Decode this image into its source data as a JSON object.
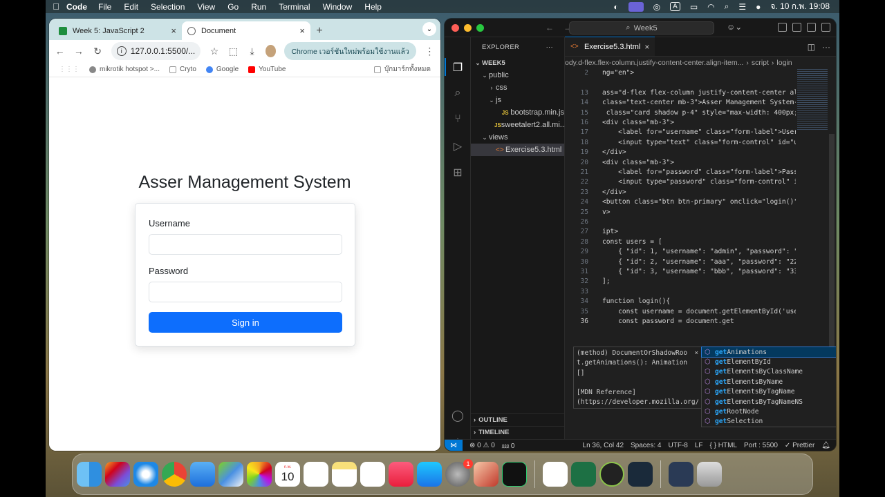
{
  "menubar": {
    "app": "Code",
    "items": [
      "File",
      "Edit",
      "Selection",
      "View",
      "Go",
      "Run",
      "Terminal",
      "Window",
      "Help"
    ],
    "datetime": "จ. 10 ก.พ.  19:08",
    "keyboard": "A"
  },
  "chrome": {
    "tabs": [
      {
        "label": "Week 5: JavaScript 2",
        "close": "×"
      },
      {
        "label": "Document",
        "close": "×"
      }
    ],
    "new_tab": "+",
    "url": "127.0.0.1:5500/...",
    "update_text": "Chrome เวอร์ชันใหม่พร้อมใช้งานแล้ว",
    "bookmarks": [
      "mikrotik hotspot >...",
      "Cryto",
      "Google",
      "YouTube"
    ],
    "bookmarks_all": "บุ๊กมาร์กทั้งหมด"
  },
  "page": {
    "title": "Asser Management System",
    "username_label": "Username",
    "password_label": "Password",
    "signin_label": "Sign in"
  },
  "vscode": {
    "search": "Week5",
    "explorer_title": "EXPLORER",
    "explorer_more": "···",
    "tree": [
      {
        "label": "WEEK5",
        "depth": 0,
        "chev": "⌄",
        "kind": "root"
      },
      {
        "label": "public",
        "depth": 1,
        "chev": "⌄",
        "kind": "folder"
      },
      {
        "label": "css",
        "depth": 2,
        "chev": "›",
        "kind": "folder"
      },
      {
        "label": "js",
        "depth": 2,
        "chev": "⌄",
        "kind": "folder"
      },
      {
        "label": "bootstrap.min.js",
        "depth": 3,
        "chev": "",
        "kind": "js"
      },
      {
        "label": "sweetalert2.all.mi...",
        "depth": 3,
        "chev": "",
        "kind": "js"
      },
      {
        "label": "views",
        "depth": 1,
        "chev": "⌄",
        "kind": "folder"
      },
      {
        "label": "Exercise5.3.html",
        "depth": 2,
        "chev": "",
        "kind": "html"
      }
    ],
    "js_badge": "JS",
    "html_badge": "<>",
    "outline": "OUTLINE",
    "timeline": "TIMELINE",
    "editor_tab": "Exercise5.3.html",
    "breadcrumb": [
      "ody.d-flex.flex-column.justify-content-center.align-item...",
      "script",
      "login"
    ],
    "code_lines": [
      {
        "n": "2",
        "t": "ng=\"en\">"
      },
      {
        "n": "",
        "t": ""
      },
      {
        "n": "13",
        "t": "ass=\"d-flex flex-column justify-content-center al"
      },
      {
        "n": "14",
        "t": "class=\"text-center mb-3\">Asser Management System-"
      },
      {
        "n": "15",
        "t": " class=\"card shadow p-4\" style=\"max-width: 400px;"
      },
      {
        "n": "16",
        "t": "<div class=\"mb-3\">"
      },
      {
        "n": "17",
        "t": "    <label for=\"username\" class=\"form-label\">User"
      },
      {
        "n": "18",
        "t": "    <input type=\"text\" class=\"form-control\" id=\"u"
      },
      {
        "n": "19",
        "t": "</div>"
      },
      {
        "n": "20",
        "t": "<div class=\"mb-3\">"
      },
      {
        "n": "21",
        "t": "    <label for=\"password\" class=\"form-label\">Pass"
      },
      {
        "n": "22",
        "t": "    <input type=\"password\" class=\"form-control\" i"
      },
      {
        "n": "23",
        "t": "</div>"
      },
      {
        "n": "24",
        "t": "<button class=\"btn btn-primary\" onclick=\"login()\""
      },
      {
        "n": "25",
        "t": "v>"
      },
      {
        "n": "26",
        "t": ""
      },
      {
        "n": "27",
        "t": "ipt>"
      },
      {
        "n": "28",
        "t": "const users = ["
      },
      {
        "n": "29",
        "t": "    { \"id\": 1, \"username\": \"admin\", \"password\": \""
      },
      {
        "n": "30",
        "t": "    { \"id\": 2, \"username\": \"aaa\", \"password\": \"22"
      },
      {
        "n": "31",
        "t": "    { \"id\": 3, \"username\": \"bbb\", \"password\": \"33"
      },
      {
        "n": "32",
        "t": "];"
      },
      {
        "n": "33",
        "t": ""
      },
      {
        "n": "34",
        "t": "function login(){"
      },
      {
        "n": "35",
        "t": "    const username = document.getElementById('use"
      },
      {
        "n": "36",
        "t": "    const password = document.get"
      }
    ],
    "hover_doc": [
      "(method) DocumentOrShadowRoo",
      "t.getAnimations(): Animation",
      "[]",
      "",
      "[MDN Reference]",
      "(https://developer.mozilla.org/docs/Web/"
    ],
    "hover_close": "×",
    "suggestions": [
      {
        "prefix": "get",
        "rest": "Animations"
      },
      {
        "prefix": "get",
        "rest": "ElementById"
      },
      {
        "prefix": "get",
        "rest": "ElementsByClassName"
      },
      {
        "prefix": "get",
        "rest": "ElementsByName"
      },
      {
        "prefix": "get",
        "rest": "ElementsByTagName"
      },
      {
        "prefix": "get",
        "rest": "ElementsByTagNameNS"
      },
      {
        "prefix": "get",
        "rest": "RootNode"
      },
      {
        "prefix": "get",
        "rest": "Selection"
      }
    ],
    "status": {
      "problems": "⊗ 0 ⚠ 0",
      "ports": "⅏ 0",
      "position": "Ln 36, Col 42",
      "spaces": "Spaces: 4",
      "encoding": "UTF-8",
      "eol": "LF",
      "language": "{ } HTML",
      "port": "Port : 5500",
      "prettier": "✓ Prettier"
    }
  },
  "dock": {
    "calendar_month": "ก.พ.",
    "calendar_day": "10",
    "badge": "1"
  }
}
